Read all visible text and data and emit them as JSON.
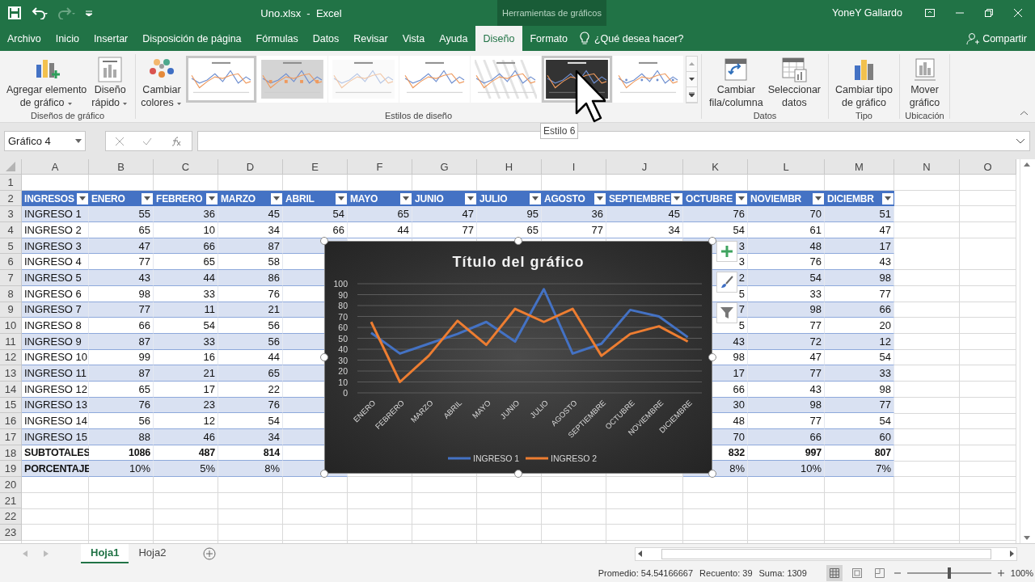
{
  "title_bar": {
    "title": "Uno.xlsx  -  Excel",
    "context": "Herramientas de gráficos",
    "user": "YoneY Gallardo"
  },
  "tabs": [
    {
      "label": "Archivo",
      "selected": false
    },
    {
      "label": "Inicio",
      "selected": false
    },
    {
      "label": "Insertar",
      "selected": false
    },
    {
      "label": "Disposición de página",
      "selected": false
    },
    {
      "label": "Fórmulas",
      "selected": false
    },
    {
      "label": "Datos",
      "selected": false
    },
    {
      "label": "Revisar",
      "selected": false
    },
    {
      "label": "Vista",
      "selected": false
    },
    {
      "label": "Ayuda",
      "selected": false
    },
    {
      "label": "Diseño",
      "selected": true
    },
    {
      "label": "Formato",
      "selected": false
    }
  ],
  "tell_me": "¿Qué desea hacer?",
  "share": "Compartir",
  "ribbon": {
    "groups": [
      {
        "label": "Diseños de gráfico",
        "buttons": [
          {
            "lines": [
              "Agregar elemento",
              "de gráfico"
            ],
            "menu": true
          },
          {
            "lines": [
              "Diseño",
              "rápido"
            ],
            "menu": true
          }
        ]
      },
      {
        "label": "Estilos de diseño",
        "buttons": [
          {
            "lines": [
              "Cambiar",
              "colores"
            ],
            "menu": true
          }
        ],
        "gallery": [
          {
            "kind": "plain",
            "highlighted": true
          },
          {
            "kind": "shaded",
            "highlighted": false
          },
          {
            "kind": "faded",
            "highlighted": false
          },
          {
            "kind": "plain",
            "highlighted": false
          },
          {
            "kind": "hatched",
            "highlighted": false
          },
          {
            "kind": "dark",
            "highlighted": true
          },
          {
            "kind": "markers",
            "highlighted": false
          }
        ]
      },
      {
        "label": "Datos",
        "buttons": [
          {
            "lines": [
              "Cambiar",
              "fila/columna"
            ],
            "menu": false
          },
          {
            "lines": [
              "Seleccionar",
              "datos"
            ],
            "menu": false
          }
        ]
      },
      {
        "label": "Tipo",
        "buttons": [
          {
            "lines": [
              "Cambiar tipo",
              "de gráfico"
            ],
            "menu": false
          }
        ]
      },
      {
        "label": "Ubicación",
        "buttons": [
          {
            "lines": [
              "Mover",
              "gráfico"
            ],
            "menu": false
          }
        ]
      }
    ]
  },
  "tooltip": "Estilo 6",
  "formula_bar": {
    "name_box": "Gráfico 4"
  },
  "sheet": {
    "columns": [
      "A",
      "B",
      "C",
      "D",
      "E",
      "F",
      "G",
      "H",
      "I",
      "J",
      "K",
      "L",
      "M",
      "N",
      "O"
    ],
    "rows": [
      {
        "number": "1",
        "kind": "empty"
      },
      {
        "number": "2",
        "kind": "header",
        "cells": [
          "INGRESOS",
          "ENERO",
          "FEBRERO",
          "MARZO",
          "ABRIL",
          "MAYO",
          "JUNIO",
          "JULIO",
          "AGOSTO",
          "SEPTIEMBRE",
          "OCTUBRE",
          "NOVIEMBR",
          "DICIEMBR"
        ]
      },
      {
        "number": "3",
        "kind": "data",
        "banded": true,
        "cells": [
          "INGRESO 1",
          "55",
          "36",
          "45",
          "54",
          "65",
          "47",
          "95",
          "36",
          "45",
          "76",
          "70",
          "51"
        ]
      },
      {
        "number": "4",
        "kind": "data",
        "banded": false,
        "cells": [
          "INGRESO 2",
          "65",
          "10",
          "34",
          "66",
          "44",
          "77",
          "65",
          "77",
          "34",
          "54",
          "61",
          "47"
        ]
      },
      {
        "number": "5",
        "kind": "data",
        "banded": true,
        "cells": [
          "INGRESO 3",
          "47",
          "66",
          "87"
        ],
        "tail": [
          "3",
          "48",
          "17"
        ]
      },
      {
        "number": "6",
        "kind": "data",
        "banded": false,
        "cells": [
          "INGRESO 4",
          "77",
          "65",
          "58"
        ],
        "tail": [
          "3",
          "76",
          "43"
        ]
      },
      {
        "number": "7",
        "kind": "data",
        "banded": true,
        "cells": [
          "INGRESO 5",
          "43",
          "44",
          "86"
        ],
        "tail": [
          "2",
          "54",
          "98"
        ]
      },
      {
        "number": "8",
        "kind": "data",
        "banded": false,
        "cells": [
          "INGRESO 6",
          "98",
          "33",
          "76"
        ],
        "tail": [
          "5",
          "33",
          "77"
        ]
      },
      {
        "number": "9",
        "kind": "data",
        "banded": true,
        "cells": [
          "INGRESO 7",
          "77",
          "11",
          "21"
        ],
        "tail": [
          "7",
          "98",
          "66"
        ]
      },
      {
        "number": "10",
        "kind": "data",
        "banded": false,
        "cells": [
          "INGRESO 8",
          "66",
          "54",
          "56"
        ],
        "tail": [
          "5",
          "77",
          "20"
        ]
      },
      {
        "number": "11",
        "kind": "data",
        "banded": true,
        "cells": [
          "INGRESO 9",
          "87",
          "33",
          "56"
        ],
        "tail": [
          "43",
          "72",
          "12"
        ]
      },
      {
        "number": "12",
        "kind": "data",
        "banded": false,
        "cells": [
          "INGRESO 10",
          "99",
          "16",
          "44"
        ],
        "tail": [
          "98",
          "47",
          "54"
        ]
      },
      {
        "number": "13",
        "kind": "data",
        "banded": true,
        "cells": [
          "INGRESO 11",
          "87",
          "21",
          "65"
        ],
        "tail": [
          "17",
          "77",
          "33"
        ]
      },
      {
        "number": "14",
        "kind": "data",
        "banded": false,
        "cells": [
          "INGRESO 12",
          "65",
          "17",
          "22"
        ],
        "tail": [
          "66",
          "43",
          "98"
        ]
      },
      {
        "number": "15",
        "kind": "data",
        "banded": true,
        "cells": [
          "INGRESO 13",
          "76",
          "23",
          "76"
        ],
        "tail": [
          "30",
          "98",
          "77"
        ]
      },
      {
        "number": "16",
        "kind": "data",
        "banded": false,
        "cells": [
          "INGRESO 14",
          "56",
          "12",
          "54"
        ],
        "tail": [
          "48",
          "77",
          "54"
        ]
      },
      {
        "number": "17",
        "kind": "data",
        "banded": true,
        "cells": [
          "INGRESO 15",
          "88",
          "46",
          "34"
        ],
        "tail": [
          "70",
          "66",
          "60"
        ]
      },
      {
        "number": "18",
        "kind": "total",
        "banded": false,
        "cells": [
          "SUBTOTALES",
          "1086",
          "487",
          "814"
        ],
        "tail": [
          "832",
          "997",
          "807"
        ]
      },
      {
        "number": "19",
        "kind": "percent",
        "banded": true,
        "cells": [
          "PORCENTAJE",
          "10%",
          "5%",
          "8%"
        ],
        "tail": [
          "8%",
          "10%",
          "7%"
        ]
      },
      {
        "number": "20",
        "kind": "empty"
      },
      {
        "number": "21",
        "kind": "empty"
      },
      {
        "number": "22",
        "kind": "empty"
      },
      {
        "number": "23",
        "kind": "empty"
      }
    ]
  },
  "chart": {
    "selected": true,
    "chart_data": {
      "type": "line",
      "title": "Título del gráfico",
      "categories": [
        "ENERO",
        "FEBRERO",
        "MARZO",
        "ABRIL",
        "MAYO",
        "JUNIO",
        "JULIO",
        "AGOSTO",
        "SEPTIEMBRE",
        "OCTUBRE",
        "NOVIEMBRE",
        "DICIEMBRE"
      ],
      "series": [
        {
          "name": "INGRESO 1",
          "color": "#4472c4",
          "values": [
            55,
            36,
            45,
            54,
            65,
            47,
            95,
            36,
            45,
            76,
            70,
            51
          ]
        },
        {
          "name": "INGRESO 2",
          "color": "#ed7d31",
          "values": [
            65,
            10,
            34,
            66,
            44,
            77,
            65,
            77,
            34,
            54,
            61,
            47
          ]
        }
      ],
      "ylim": [
        0,
        100
      ],
      "yticks": [
        0,
        10,
        20,
        30,
        40,
        50,
        60,
        70,
        80,
        90,
        100
      ],
      "grid": true,
      "legend": "bottom"
    }
  },
  "sheet_tabs": [
    {
      "label": "Hoja1",
      "selected": true
    },
    {
      "label": "Hoja2",
      "selected": false
    }
  ],
  "status_bar": {
    "stats": [
      "Promedio: 54.54166667",
      "Recuento: 39",
      "Suma: 1309"
    ],
    "views": [
      {
        "kind": "normal",
        "selected": true
      },
      {
        "kind": "page-layout",
        "selected": false
      },
      {
        "kind": "page-break",
        "selected": false
      }
    ],
    "zoom": {
      "level": 0.5,
      "reading": "100%"
    }
  }
}
